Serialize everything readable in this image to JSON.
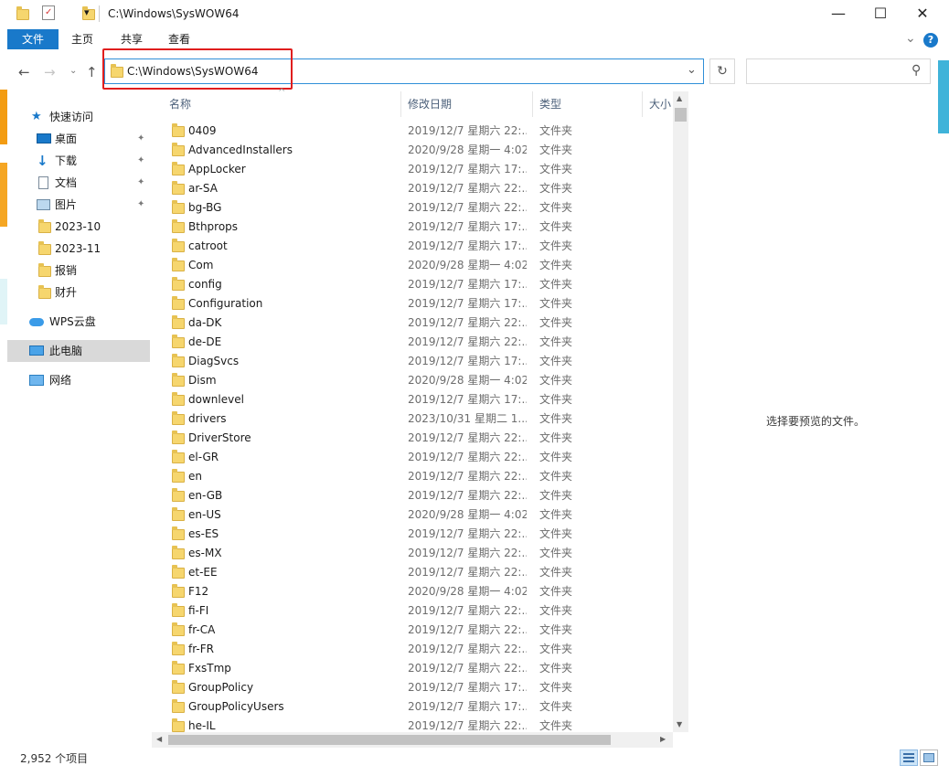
{
  "titlebar": {
    "path": "C:\\Windows\\SysWOW64",
    "qat_dropdown": "▾",
    "minimize": "—",
    "maximize": "☐",
    "close": "✕"
  },
  "ribbon": {
    "tabs": [
      "文件",
      "主页",
      "共享",
      "查看"
    ],
    "expand": "⌄",
    "help": "?"
  },
  "nav": {
    "back": "←",
    "forward": "→",
    "dropdown": "⌄",
    "up": "↑",
    "address": "C:\\Windows\\SysWOW64",
    "address_dropdown": "⌄",
    "refresh": "↻",
    "search_placeholder": "",
    "search_icon": "⚲"
  },
  "sidebar": {
    "quick_access": "快速访问",
    "quick_items": [
      {
        "label": "桌面",
        "icon": "desktop-icon",
        "pinned": true
      },
      {
        "label": "下载",
        "icon": "download-icon",
        "pinned": true
      },
      {
        "label": "文档",
        "icon": "document-icon",
        "pinned": true
      },
      {
        "label": "图片",
        "icon": "pictures-icon",
        "pinned": true
      },
      {
        "label": "2023-10",
        "icon": "folder-icon",
        "pinned": false
      },
      {
        "label": "2023-11",
        "icon": "folder-icon",
        "pinned": false
      },
      {
        "label": "报销",
        "icon": "folder-icon",
        "pinned": false
      },
      {
        "label": "财升",
        "icon": "folder-icon",
        "pinned": false
      }
    ],
    "wps": "WPS云盘",
    "this_pc": "此电脑",
    "network": "网络",
    "pin_glyph": "✦"
  },
  "columns": {
    "name": "名称",
    "date": "修改日期",
    "type": "类型",
    "size": "大小",
    "sort_glyph": "^"
  },
  "files": [
    {
      "name": "0409",
      "date": "2019/12/7 星期六 22:...",
      "type": "文件夹"
    },
    {
      "name": "AdvancedInstallers",
      "date": "2020/9/28 星期一 4:02",
      "type": "文件夹"
    },
    {
      "name": "AppLocker",
      "date": "2019/12/7 星期六 17:...",
      "type": "文件夹"
    },
    {
      "name": "ar-SA",
      "date": "2019/12/7 星期六 22:...",
      "type": "文件夹"
    },
    {
      "name": "bg-BG",
      "date": "2019/12/7 星期六 22:...",
      "type": "文件夹"
    },
    {
      "name": "Bthprops",
      "date": "2019/12/7 星期六 17:...",
      "type": "文件夹"
    },
    {
      "name": "catroot",
      "date": "2019/12/7 星期六 17:...",
      "type": "文件夹"
    },
    {
      "name": "Com",
      "date": "2020/9/28 星期一 4:02",
      "type": "文件夹"
    },
    {
      "name": "config",
      "date": "2019/12/7 星期六 17:...",
      "type": "文件夹"
    },
    {
      "name": "Configuration",
      "date": "2019/12/7 星期六 17:...",
      "type": "文件夹"
    },
    {
      "name": "da-DK",
      "date": "2019/12/7 星期六 22:...",
      "type": "文件夹"
    },
    {
      "name": "de-DE",
      "date": "2019/12/7 星期六 22:...",
      "type": "文件夹"
    },
    {
      "name": "DiagSvcs",
      "date": "2019/12/7 星期六 17:...",
      "type": "文件夹"
    },
    {
      "name": "Dism",
      "date": "2020/9/28 星期一 4:02",
      "type": "文件夹"
    },
    {
      "name": "downlevel",
      "date": "2019/12/7 星期六 17:...",
      "type": "文件夹"
    },
    {
      "name": "drivers",
      "date": "2023/10/31 星期二 1...",
      "type": "文件夹"
    },
    {
      "name": "DriverStore",
      "date": "2019/12/7 星期六 22:...",
      "type": "文件夹"
    },
    {
      "name": "el-GR",
      "date": "2019/12/7 星期六 22:...",
      "type": "文件夹"
    },
    {
      "name": "en",
      "date": "2019/12/7 星期六 22:...",
      "type": "文件夹"
    },
    {
      "name": "en-GB",
      "date": "2019/12/7 星期六 22:...",
      "type": "文件夹"
    },
    {
      "name": "en-US",
      "date": "2020/9/28 星期一 4:02",
      "type": "文件夹"
    },
    {
      "name": "es-ES",
      "date": "2019/12/7 星期六 22:...",
      "type": "文件夹"
    },
    {
      "name": "es-MX",
      "date": "2019/12/7 星期六 22:...",
      "type": "文件夹"
    },
    {
      "name": "et-EE",
      "date": "2019/12/7 星期六 22:...",
      "type": "文件夹"
    },
    {
      "name": "F12",
      "date": "2020/9/28 星期一 4:02",
      "type": "文件夹"
    },
    {
      "name": "fi-FI",
      "date": "2019/12/7 星期六 22:...",
      "type": "文件夹"
    },
    {
      "name": "fr-CA",
      "date": "2019/12/7 星期六 22:...",
      "type": "文件夹"
    },
    {
      "name": "fr-FR",
      "date": "2019/12/7 星期六 22:...",
      "type": "文件夹"
    },
    {
      "name": "FxsTmp",
      "date": "2019/12/7 星期六 22:...",
      "type": "文件夹"
    },
    {
      "name": "GroupPolicy",
      "date": "2019/12/7 星期六 17:...",
      "type": "文件夹"
    },
    {
      "name": "GroupPolicyUsers",
      "date": "2019/12/7 星期六 17:...",
      "type": "文件夹"
    },
    {
      "name": "he-IL",
      "date": "2019/12/7 星期六 22:...",
      "type": "文件夹"
    }
  ],
  "scroll": {
    "up": "▲",
    "down": "▼",
    "left": "◀",
    "right": "▶"
  },
  "preview": {
    "message": "选择要预览的文件。"
  },
  "status": {
    "count": "2,952 个项目"
  },
  "colors": {
    "accent": "#1979ca",
    "highlight": "#e01e1e",
    "selected": "#d9d9d9",
    "folder": "#f6d66e"
  }
}
